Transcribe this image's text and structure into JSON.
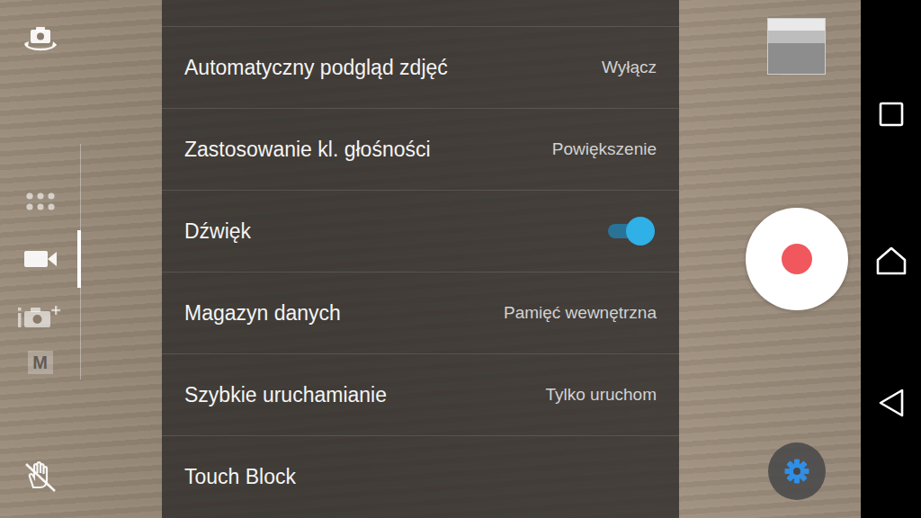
{
  "modes": [
    {
      "kind": "apps",
      "selected": false
    },
    {
      "kind": "video",
      "selected": true
    },
    {
      "kind": "superior",
      "selected": false
    },
    {
      "kind": "manual",
      "selected": false,
      "label": "M"
    }
  ],
  "settings": [
    {
      "kind": "value",
      "label": "Automatyczny podgląd zdjęć",
      "value": "Wyłącz"
    },
    {
      "kind": "value",
      "label": "Zastosowanie kl. głośności",
      "value": "Powiększenie"
    },
    {
      "kind": "toggle",
      "label": "Dźwięk",
      "on": true
    },
    {
      "kind": "value",
      "label": "Magazyn danych",
      "value": "Pamięć wewnętrzna"
    },
    {
      "kind": "value",
      "label": "Szybkie uruchamianie",
      "value": "Tylko uruchom"
    },
    {
      "kind": "plain",
      "label": "Touch Block"
    }
  ]
}
